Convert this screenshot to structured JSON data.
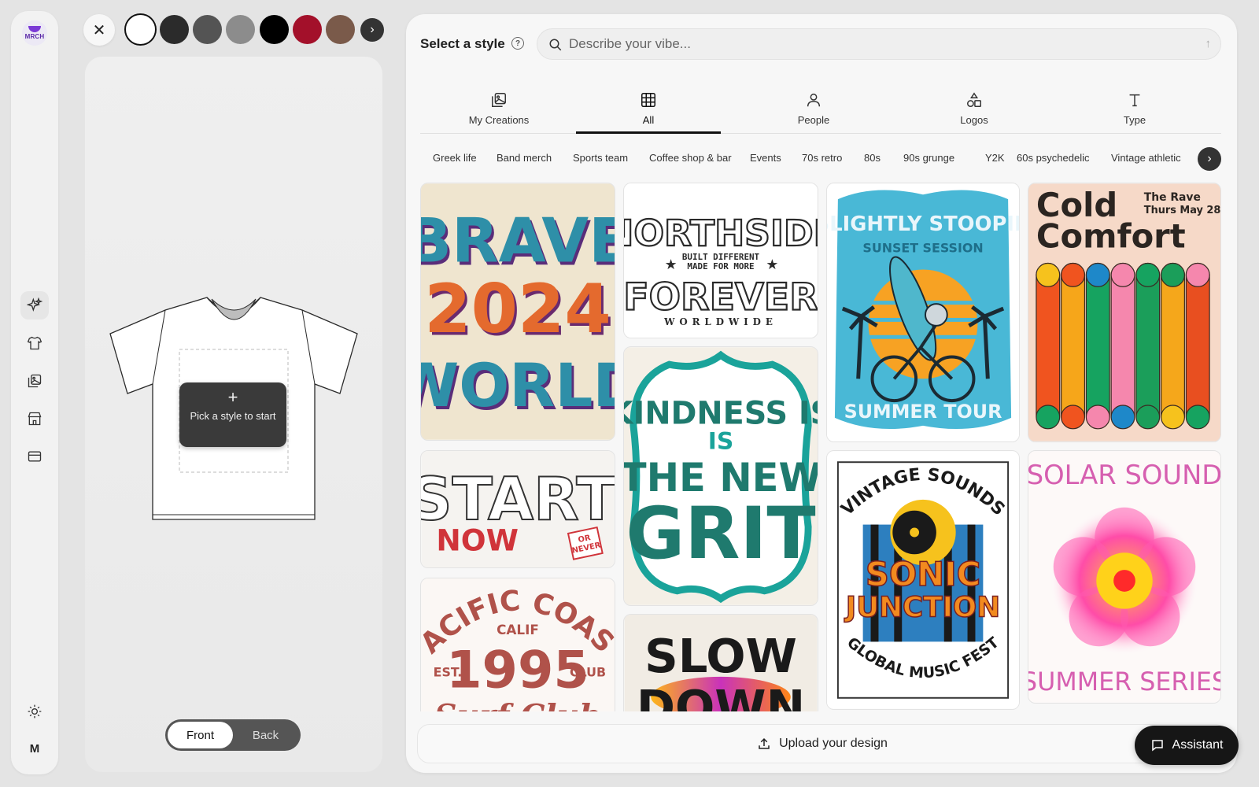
{
  "rail": {
    "logo_text": "MRCH",
    "items": [
      {
        "icon": "sparkle-icon",
        "active": true
      },
      {
        "icon": "tshirt-icon",
        "active": false
      },
      {
        "icon": "gallery-icon",
        "active": false
      },
      {
        "icon": "store-icon",
        "active": false
      },
      {
        "icon": "card-icon",
        "active": false
      }
    ],
    "theme_icon": "sun-icon",
    "user_initial": "M"
  },
  "colors": {
    "swatches": [
      "#ffffff",
      "#2b2b2b",
      "#545454",
      "#8c8c8c",
      "#000000",
      "#a3102a",
      "#7a5a4a"
    ],
    "selected_index": 0
  },
  "preview": {
    "pick_label": "Pick a style to start",
    "front_label": "Front",
    "back_label": "Back",
    "active_side": "Front"
  },
  "style": {
    "title": "Select a style",
    "search_placeholder": "Describe your vibe..."
  },
  "tabs": [
    {
      "label": "My Creations",
      "icon": "creations-icon"
    },
    {
      "label": "All",
      "icon": "grid-icon",
      "active": true
    },
    {
      "label": "People",
      "icon": "person-icon"
    },
    {
      "label": "Logos",
      "icon": "shapes-icon"
    },
    {
      "label": "Type",
      "icon": "type-icon"
    }
  ],
  "categories": [
    "Greek life",
    "Band merch",
    "Sports team",
    "Coffee shop & bar",
    "Events",
    "70s retro",
    "80s",
    "90s grunge",
    "Y2K",
    "60s psychedelic",
    "Vintage athletic"
  ],
  "cards": {
    "brave": {
      "line1": "BRAVE",
      "line2": "2024",
      "line3": "WORLD"
    },
    "northside": {
      "line1": "NORTHSIDE",
      "sub1": "BUILT DIFFERENT",
      "sub2": "MADE FOR MORE",
      "line2": "FOREVER",
      "line3": "WORLDWIDE"
    },
    "sunset": {
      "top": "SLIGHTLY STOOPID",
      "sub": "SUNSET SESSION",
      "bottom": "SUMMER TOUR"
    },
    "cold": {
      "line1": "Cold",
      "line2": "Comfort",
      "event1": "The Rave",
      "event2": "Thurs May 28"
    },
    "start": {
      "line1": "START",
      "line2": "NOW",
      "stamp1": "OR",
      "stamp2": "NEVER"
    },
    "kindness": {
      "line1": "KINDNESS IS",
      "line2": "IS",
      "line3": "THE NEW",
      "line4": "GRIT"
    },
    "sonic": {
      "top": "VINTAGE SOUNDS",
      "line1": "SONIC",
      "line2": "JUNCTION",
      "bottom": "GLOBAL MUSIC FEST"
    },
    "solar": {
      "top": "SOLAR SOUND",
      "bottom": "SUMMER SERIES"
    },
    "pacific": {
      "arc": "PACIFIC COAST",
      "calif": "CALIF",
      "year": "1995",
      "est": "EST.",
      "club": "CLUB",
      "script": "Surf Club"
    },
    "slow": {
      "line1": "SLOW",
      "line2": "DOWN"
    }
  },
  "footer": {
    "upload_label": "Upload your design",
    "assistant_label": "Assistant"
  }
}
